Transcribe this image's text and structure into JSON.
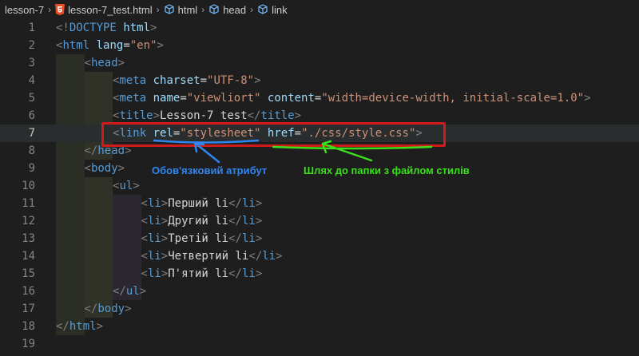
{
  "breadcrumb": {
    "folder": "lesson-7",
    "file": "lesson-7_test.html",
    "path": [
      "html",
      "head",
      "link"
    ]
  },
  "editor": {
    "current_line": 7,
    "lines": [
      {
        "num": "1",
        "indent": 0,
        "tokens": [
          [
            "tag-b",
            "<!"
          ],
          [
            "tag-n",
            "DOCTYPE"
          ],
          [
            "txt",
            " "
          ],
          [
            "attr",
            "html"
          ],
          [
            "tag-b",
            ">"
          ]
        ]
      },
      {
        "num": "2",
        "indent": 0,
        "tokens": [
          [
            "tag-b",
            "<"
          ],
          [
            "tag-n",
            "html"
          ],
          [
            "txt",
            " "
          ],
          [
            "attr",
            "lang"
          ],
          [
            "txt",
            "="
          ],
          [
            "str",
            "\"en\""
          ],
          [
            "tag-b",
            ">"
          ]
        ]
      },
      {
        "num": "3",
        "indent": 1,
        "tokens": [
          [
            "tag-b",
            "<"
          ],
          [
            "tag-n",
            "head"
          ],
          [
            "tag-b",
            ">"
          ]
        ]
      },
      {
        "num": "4",
        "indent": 2,
        "tokens": [
          [
            "tag-b",
            "<"
          ],
          [
            "tag-n",
            "meta"
          ],
          [
            "txt",
            " "
          ],
          [
            "attr",
            "charset"
          ],
          [
            "txt",
            "="
          ],
          [
            "str",
            "\"UTF-8\""
          ],
          [
            "tag-b",
            ">"
          ]
        ]
      },
      {
        "num": "5",
        "indent": 2,
        "tokens": [
          [
            "tag-b",
            "<"
          ],
          [
            "tag-n",
            "meta"
          ],
          [
            "txt",
            " "
          ],
          [
            "attr",
            "name"
          ],
          [
            "txt",
            "="
          ],
          [
            "str",
            "\"viewliort\""
          ],
          [
            "txt",
            " "
          ],
          [
            "attr",
            "content"
          ],
          [
            "txt",
            "="
          ],
          [
            "str",
            "\"width=device-width, initial-scale=1.0\""
          ],
          [
            "tag-b",
            ">"
          ]
        ]
      },
      {
        "num": "6",
        "indent": 2,
        "tokens": [
          [
            "tag-b",
            "<"
          ],
          [
            "tag-n",
            "title"
          ],
          [
            "tag-b",
            ">"
          ],
          [
            "txt",
            "Lesson-7 test"
          ],
          [
            "tag-b",
            "</"
          ],
          [
            "tag-n",
            "title"
          ],
          [
            "tag-b",
            ">"
          ]
        ]
      },
      {
        "num": "7",
        "indent": 2,
        "tokens": [
          [
            "tag-b",
            "<"
          ],
          [
            "tag-n",
            "link"
          ],
          [
            "txt",
            " "
          ],
          [
            "attr",
            "rel"
          ],
          [
            "txt",
            "="
          ],
          [
            "str",
            "\"stylesheet\""
          ],
          [
            "txt",
            " "
          ],
          [
            "attr",
            "href"
          ],
          [
            "txt",
            "="
          ],
          [
            "str",
            "\"./css/style.css\""
          ],
          [
            "tag-b",
            ">"
          ]
        ]
      },
      {
        "num": "8",
        "indent": 1,
        "tokens": [
          [
            "tag-b",
            "</"
          ],
          [
            "tag-n",
            "head"
          ],
          [
            "tag-b",
            ">"
          ]
        ]
      },
      {
        "num": "9",
        "indent": 1,
        "tokens": [
          [
            "tag-b",
            "<"
          ],
          [
            "tag-n",
            "body"
          ],
          [
            "tag-b",
            ">"
          ]
        ]
      },
      {
        "num": "10",
        "indent": 2,
        "tokens": [
          [
            "tag-b",
            "<"
          ],
          [
            "tag-n",
            "ul"
          ],
          [
            "tag-b",
            ">"
          ]
        ]
      },
      {
        "num": "11",
        "indent": 3,
        "tokens": [
          [
            "tag-b",
            "<"
          ],
          [
            "tag-n",
            "li"
          ],
          [
            "tag-b",
            ">"
          ],
          [
            "txt",
            "Перший li"
          ],
          [
            "tag-b",
            "</"
          ],
          [
            "tag-n",
            "li"
          ],
          [
            "tag-b",
            ">"
          ]
        ]
      },
      {
        "num": "12",
        "indent": 3,
        "tokens": [
          [
            "tag-b",
            "<"
          ],
          [
            "tag-n",
            "li"
          ],
          [
            "tag-b",
            ">"
          ],
          [
            "txt",
            "Другий li"
          ],
          [
            "tag-b",
            "</"
          ],
          [
            "tag-n",
            "li"
          ],
          [
            "tag-b",
            ">"
          ]
        ]
      },
      {
        "num": "13",
        "indent": 3,
        "tokens": [
          [
            "tag-b",
            "<"
          ],
          [
            "tag-n",
            "li"
          ],
          [
            "tag-b",
            ">"
          ],
          [
            "txt",
            "Третій li"
          ],
          [
            "tag-b",
            "</"
          ],
          [
            "tag-n",
            "li"
          ],
          [
            "tag-b",
            ">"
          ]
        ]
      },
      {
        "num": "14",
        "indent": 3,
        "tokens": [
          [
            "tag-b",
            "<"
          ],
          [
            "tag-n",
            "li"
          ],
          [
            "tag-b",
            ">"
          ],
          [
            "txt",
            "Четвертий li"
          ],
          [
            "tag-b",
            "</"
          ],
          [
            "tag-n",
            "li"
          ],
          [
            "tag-b",
            ">"
          ]
        ]
      },
      {
        "num": "15",
        "indent": 3,
        "tokens": [
          [
            "tag-b",
            "<"
          ],
          [
            "tag-n",
            "li"
          ],
          [
            "tag-b",
            ">"
          ],
          [
            "txt",
            "П'ятий li"
          ],
          [
            "tag-b",
            "</"
          ],
          [
            "tag-n",
            "li"
          ],
          [
            "tag-b",
            ">"
          ]
        ]
      },
      {
        "num": "16",
        "indent": 2,
        "tokens": [
          [
            "tag-b",
            "</"
          ],
          [
            "tag-n",
            "ul"
          ],
          [
            "tag-b",
            ">"
          ]
        ]
      },
      {
        "num": "17",
        "indent": 1,
        "tokens": [
          [
            "tag-b",
            "</"
          ],
          [
            "tag-n",
            "body"
          ],
          [
            "tag-b",
            ">"
          ]
        ]
      },
      {
        "num": "18",
        "indent": 0,
        "tokens": [
          [
            "tag-b",
            "</"
          ],
          [
            "tag-n",
            "html"
          ],
          [
            "tag-b",
            ">"
          ]
        ]
      },
      {
        "num": "19",
        "indent": 0,
        "tokens": []
      }
    ]
  },
  "annotations": {
    "rel_note": "Обов'язковий атрибут",
    "href_note": "Шлях до папки з файлом стилів",
    "colors": {
      "box": "#d11a1a",
      "blue": "#2f86f0",
      "green": "#3be01b"
    }
  }
}
